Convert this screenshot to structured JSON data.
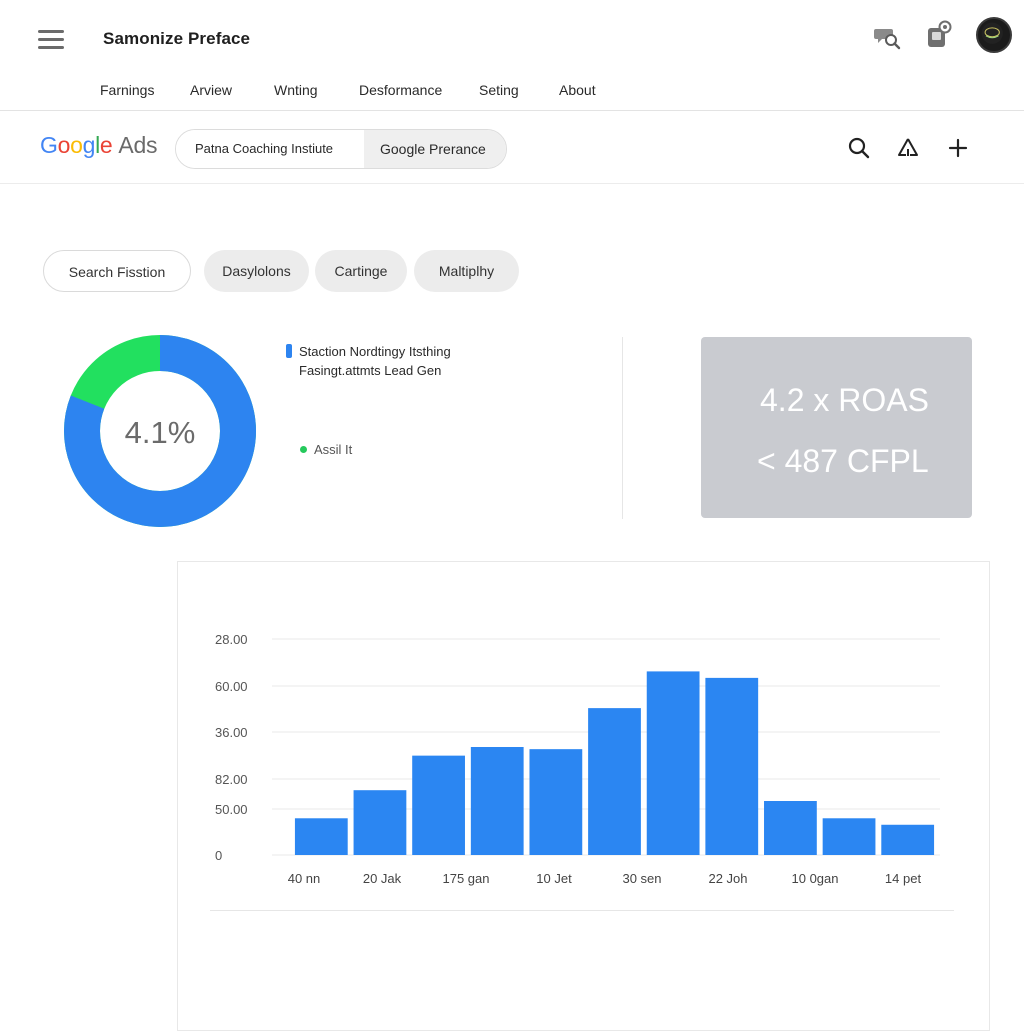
{
  "header": {
    "title": "Samonize Preface",
    "nav": [
      "Farnings",
      "Arview",
      "Wnting",
      "Desformance",
      "Seting",
      "About"
    ],
    "icons": [
      "menu-icon",
      "search-chat-icon",
      "notification-device-icon",
      "profile-avatar"
    ]
  },
  "adsbar": {
    "logo_google": "Google",
    "logo_ads": "Ads",
    "account_primary": "Patna Coaching Instiute",
    "account_secondary": "Google Prerance",
    "tools": [
      "search-icon",
      "alert-icon",
      "add-icon"
    ]
  },
  "filters": {
    "search_chip": "Search Fisstion",
    "chips": [
      "Dasylolons",
      "Cartinge",
      "Maltiplhy"
    ]
  },
  "summary": {
    "donut_label": "4.1%",
    "donut_share": 0.81,
    "legend_primary_line1": "Staction Nordtingy Itsthing",
    "legend_primary_line2": "Fasingt.attmts Lead Gen",
    "legend_secondary": "Assil It",
    "colors": {
      "primary": "#2d84f0",
      "secondary": "#22e05f"
    }
  },
  "metric_card": {
    "roas": "4.2 x ROAS",
    "cpl": "<  487 CFPL"
  },
  "chart_data": {
    "type": "bar",
    "categories": [
      "40 nn",
      "20 Jak",
      "175 gan",
      "10 Jet",
      "30 sen",
      "22 Joh",
      "10 0gan",
      "14 pet"
    ],
    "y_tick_labels": [
      "28.00",
      "60.00",
      "36.00",
      "82.00",
      "50.00",
      "0"
    ],
    "ylim": [
      0,
      100
    ],
    "series": [
      {
        "values": [
          17,
          30,
          46,
          50,
          49,
          68,
          85,
          82,
          25,
          17,
          14
        ]
      }
    ],
    "bar_color": "#2b86f2",
    "grid": true,
    "title": "",
    "xlabel": "",
    "ylabel": ""
  }
}
